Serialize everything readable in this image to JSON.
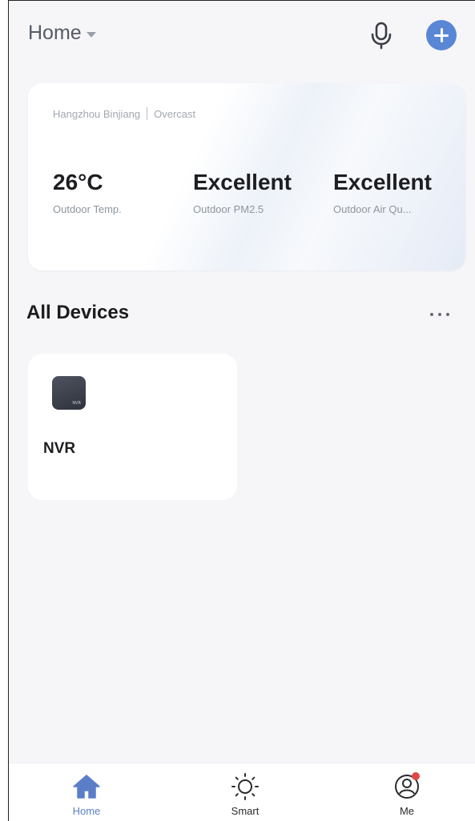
{
  "header": {
    "home_label": "Home"
  },
  "weather": {
    "location": "Hangzhou Binjiang",
    "condition": "Overcast",
    "stats": [
      {
        "value": "26°C",
        "caption": "Outdoor Temp."
      },
      {
        "value": "Excellent",
        "caption": "Outdoor PM2.5"
      },
      {
        "value": "Excellent",
        "caption": "Outdoor Air Qu..."
      }
    ]
  },
  "devices": {
    "title": "All Devices",
    "items": [
      {
        "name": "NVR",
        "icon_label": "NVR"
      }
    ]
  },
  "nav": {
    "items": [
      {
        "label": "Home",
        "icon": "home-icon",
        "active": true
      },
      {
        "label": "Smart",
        "icon": "sun-icon",
        "active": false
      },
      {
        "label": "Me",
        "icon": "profile-icon",
        "active": false,
        "badge": true
      }
    ]
  },
  "colors": {
    "accent": "#5a86d6",
    "active_nav": "#5a7fc8",
    "badge": "#e04848"
  }
}
